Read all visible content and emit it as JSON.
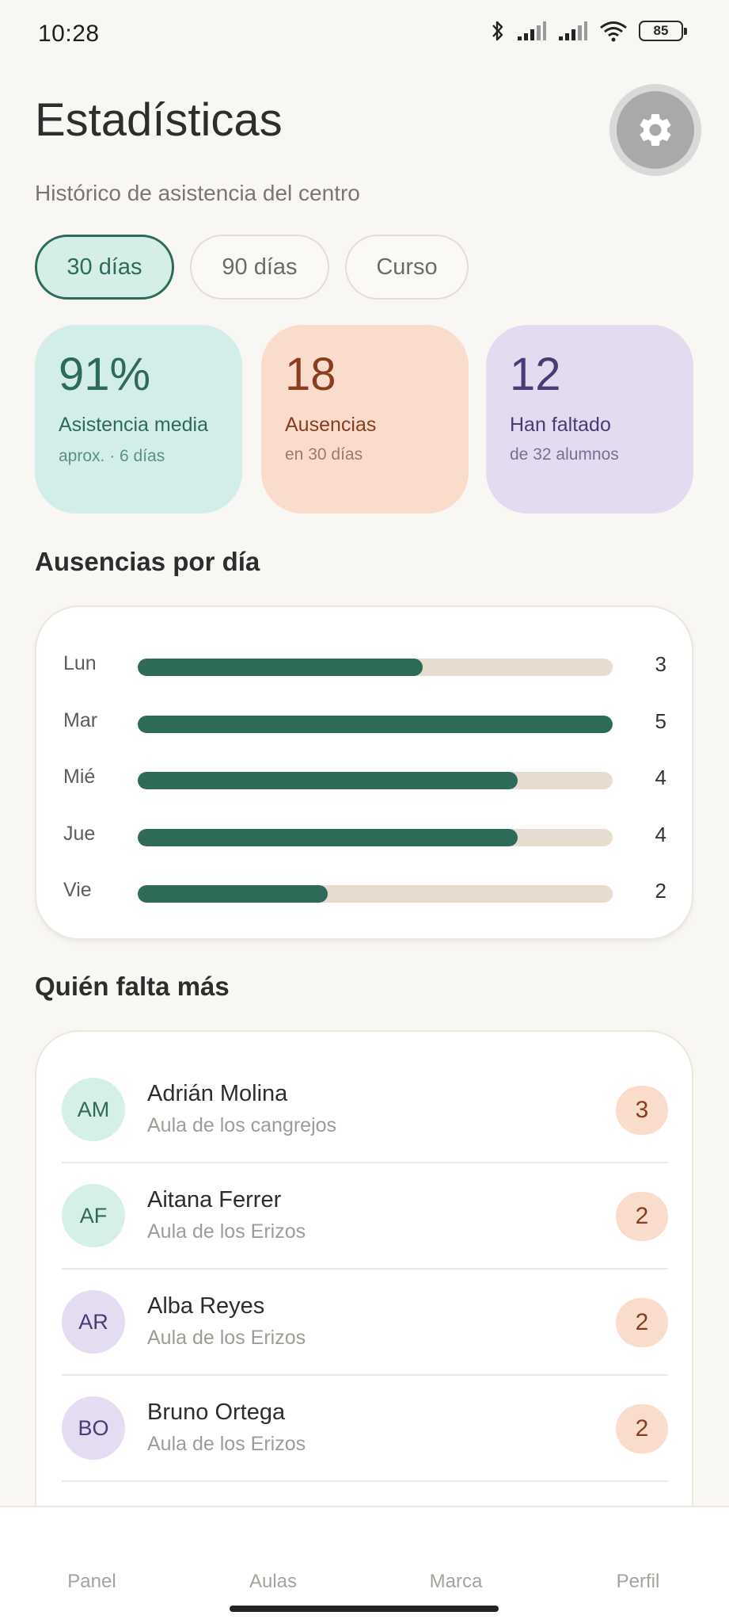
{
  "status_bar": {
    "time": "10:28",
    "battery": "85",
    "icons": [
      "bluetooth-icon",
      "signal-icon",
      "signal-icon",
      "wifi-icon",
      "battery-icon"
    ]
  },
  "header": {
    "title": "Estadísticas",
    "subtitle": "Histórico de asistencia del centro",
    "settings_icon": "gear-icon"
  },
  "periods": [
    {
      "label": "30 días",
      "active": true
    },
    {
      "label": "90 días",
      "active": false
    },
    {
      "label": "Curso",
      "active": false
    }
  ],
  "stats": {
    "attendance": {
      "value": "91%",
      "label": "Asistencia media",
      "note": "aprox. · 6 días"
    },
    "absences": {
      "value": "18",
      "label": "Ausencias",
      "note": "en 30 días"
    },
    "missed": {
      "value": "12",
      "label": "Han faltado",
      "note": "de 32 alumnos"
    }
  },
  "sections": {
    "by_day": "Ausencias por día",
    "who": "Quién falta más"
  },
  "chart_data": {
    "type": "bar",
    "orientation": "horizontal",
    "categories": [
      "Lun",
      "Mar",
      "Mié",
      "Jue",
      "Vie"
    ],
    "values": [
      3,
      5,
      4,
      4,
      2
    ],
    "xlim": [
      0,
      5
    ],
    "colors": {
      "fill": "#2d6a58",
      "track": "#e6ddd0"
    }
  },
  "students": [
    {
      "initials": "AM",
      "name": "Adrián Molina",
      "class": "Aula de los cangrejos",
      "count": "3",
      "avatar_color": "teal"
    },
    {
      "initials": "AF",
      "name": "Aitana Ferrer",
      "class": "Aula de los Erizos",
      "count": "2",
      "avatar_color": "teal"
    },
    {
      "initials": "AR",
      "name": "Alba Reyes",
      "class": "Aula de los Erizos",
      "count": "2",
      "avatar_color": "purple"
    },
    {
      "initials": "BO",
      "name": "Bruno Ortega",
      "class": "Aula de los Erizos",
      "count": "2",
      "avatar_color": "purple"
    }
  ],
  "nav": {
    "panel": "Panel",
    "aulas": "Aulas",
    "marca": "Marca",
    "perfil": "Perfil"
  },
  "colors": {
    "accent": "#2d6a58",
    "background": "#f8f7f4",
    "teal_card": "#d3eee8",
    "peach_card": "#f9dccc",
    "lavender_card": "#e3dbef"
  }
}
